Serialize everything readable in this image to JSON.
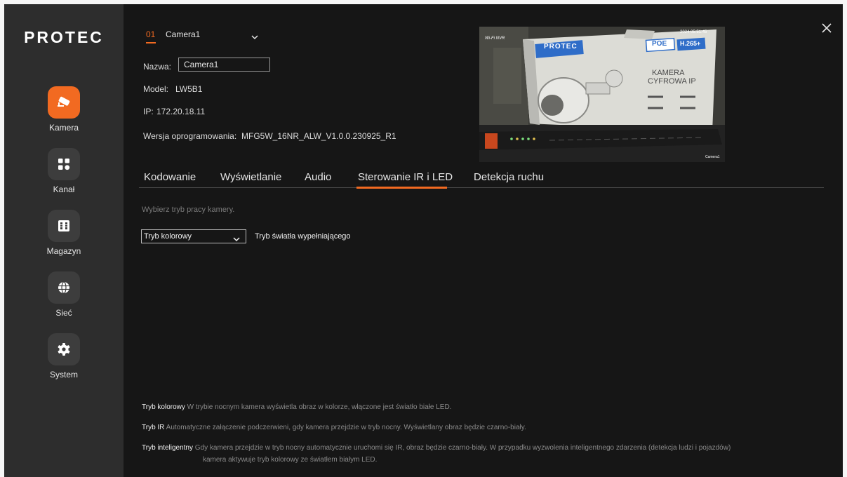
{
  "brand": {
    "logo_text": "PROTEC"
  },
  "sidebar": {
    "items": [
      {
        "label": "Kamera",
        "icon": "camera-icon",
        "active": true
      },
      {
        "label": "Kanał",
        "icon": "grid-icon",
        "active": false
      },
      {
        "label": "Magazyn",
        "icon": "storage-icon",
        "active": false
      },
      {
        "label": "Sieć",
        "icon": "globe-icon",
        "active": false
      },
      {
        "label": "System",
        "icon": "gear-icon",
        "active": false
      }
    ]
  },
  "camera": {
    "number": "01",
    "selected_name": "Camera1",
    "name_label": "Nazwa:",
    "name_value": "Camera1",
    "model_label": "Model:",
    "model_value": "LW5B1",
    "ip_label": "IP:",
    "ip_value": "172.20.18.11",
    "firmware_label": "Wersja oprogramowania:",
    "firmware_value": "MFG5W_16NR_ALW_V1.0.0.230925_R1"
  },
  "preview": {
    "overlay_left": "Wi-Fi NVR",
    "overlay_timestamp": "2024 05:51:45",
    "overlay_channel": "Camera1",
    "box_brand": "PROTEC",
    "box_poe": "POE",
    "box_codec": "H.265+",
    "box_title_1": "KAMERA",
    "box_title_2": "CYFROWA IP"
  },
  "tabs": [
    {
      "label": "Kodowanie",
      "active": false
    },
    {
      "label": "Wyświetlanie",
      "active": false
    },
    {
      "label": "Audio",
      "active": false
    },
    {
      "label": "Sterowanie IR i LED",
      "active": true
    },
    {
      "label": "Detekcja ruchu",
      "active": false
    }
  ],
  "content": {
    "instruction": "Wybierz tryb pracy kamery.",
    "mode_select_value": "Tryb kolorowy",
    "mode_select_caption": "Tryb światła wypełniającego"
  },
  "descriptions": [
    {
      "title": "Tryb kolorowy",
      "text": "W trybie nocnym kamera wyświetla obraz w kolorze, włączone jest światło białe LED."
    },
    {
      "title": "Tryb IR",
      "text": "Automatyczne załączenie podczerwieni, gdy kamera przejdzie w tryb nocny. Wyświetlany obraz będzie czarno-biały."
    },
    {
      "title": "Tryb inteligentny",
      "text": "Gdy kamera przejdzie w tryb nocny automatycznie uruchomi się IR, obraz będzie czarno-biały. W przypadku wyzwolenia inteligentnego zdarzenia (detekcja ludzi i pojazdów)",
      "text2": "kamera aktywuje tryb kolorowy ze światłem białym LED."
    }
  ],
  "colors": {
    "accent": "#f26a21",
    "background": "#161616",
    "sidebar": "#2d2d2d"
  }
}
